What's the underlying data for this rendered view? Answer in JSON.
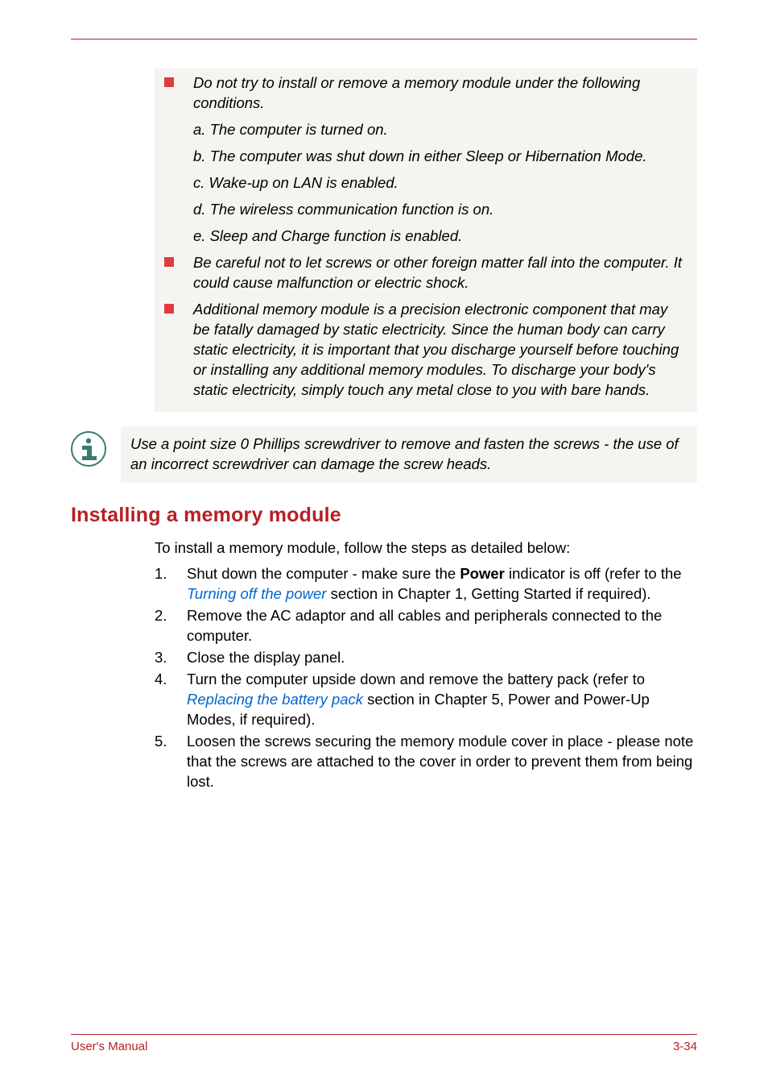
{
  "warnings": {
    "item1_intro": "Do not try to install or remove a memory module under the following conditions.",
    "sub_a": "a. The computer is turned on.",
    "sub_b": "b. The computer was shut down in either Sleep or Hibernation Mode.",
    "sub_c": "c. Wake-up on LAN is enabled.",
    "sub_d": "d. The wireless communication function is on.",
    "sub_e": "e. Sleep and Charge function is enabled.",
    "item2": "Be careful not to let screws or other foreign matter fall into the computer. It could cause malfunction or electric shock.",
    "item3": "Additional memory module is a precision electronic component that may be fatally damaged by static electricity. Since the human body can carry static electricity, it is important that you discharge yourself before touching or installing any additional memory modules. To discharge your body's static electricity, simply touch any metal close to you with bare hands."
  },
  "info_note": "Use a point size 0 Phillips screwdriver to remove and fasten the screws - the use of an incorrect screwdriver can damage the screw heads.",
  "section": {
    "heading": "Installing a memory module",
    "intro": "To install a memory module, follow the steps as detailed below:",
    "steps": {
      "s1_a": "Shut down the computer - make sure the ",
      "s1_bold": "Power",
      "s1_b": " indicator is off (refer to the ",
      "s1_link": "Turning off the power",
      "s1_c": " section in Chapter 1, Getting Started if required).",
      "s2": "Remove the AC adaptor and all cables and peripherals connected to the computer.",
      "s3": "Close the display panel.",
      "s4_a": "Turn the computer upside down and remove the battery pack (refer to ",
      "s4_link": "Replacing the battery pack",
      "s4_b": " section in Chapter 5, Power and Power-Up Modes, if required).",
      "s5": "Loosen the screws securing the memory module cover in place - please note that the screws are attached to the cover in order to prevent them from being lost."
    },
    "nums": {
      "n1": "1.",
      "n2": "2.",
      "n3": "3.",
      "n4": "4.",
      "n5": "5."
    }
  },
  "footer": {
    "left": "User's Manual",
    "right": "3-34"
  }
}
